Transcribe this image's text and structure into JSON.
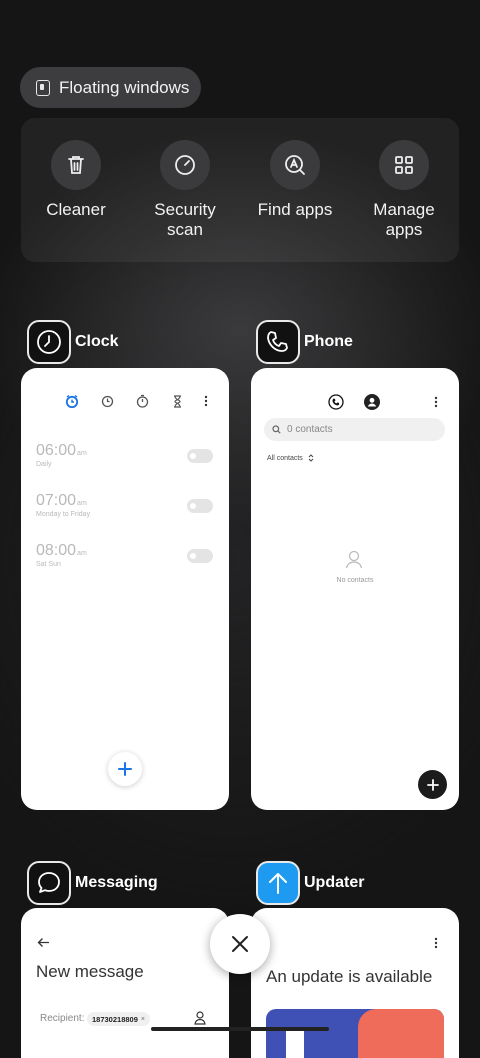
{
  "floating": {
    "label": "Floating windows",
    "icon": "floating-window-icon"
  },
  "tools": [
    {
      "label": "Cleaner",
      "icon": "trash-icon"
    },
    {
      "label": "Security scan",
      "icon": "security-scan-icon"
    },
    {
      "label": "Find apps",
      "icon": "find-apps-icon"
    },
    {
      "label": "Manage apps",
      "icon": "grid-icon"
    }
  ],
  "clock": {
    "name": "Clock",
    "alarms": [
      {
        "time": "06:00",
        "ampm": "am",
        "repeat": "Daily"
      },
      {
        "time": "07:00",
        "ampm": "am",
        "repeat": "Monday to Friday"
      },
      {
        "time": "08:00",
        "ampm": "am",
        "repeat": "Sat Sun"
      }
    ]
  },
  "phone": {
    "name": "Phone",
    "search_placeholder": "0 contacts",
    "filter": "All contacts",
    "empty": "No contacts"
  },
  "messaging": {
    "name": "Messaging",
    "title": "New message",
    "recipient_label": "Recipient:",
    "recipient": "18730218809"
  },
  "updater": {
    "name": "Updater",
    "title": "An update is available"
  },
  "colors": {
    "accent": "#1a73e8",
    "updater": "#1e9bf0",
    "banner_blue": "#3f51b5",
    "banner_red": "#ef6c5a"
  }
}
